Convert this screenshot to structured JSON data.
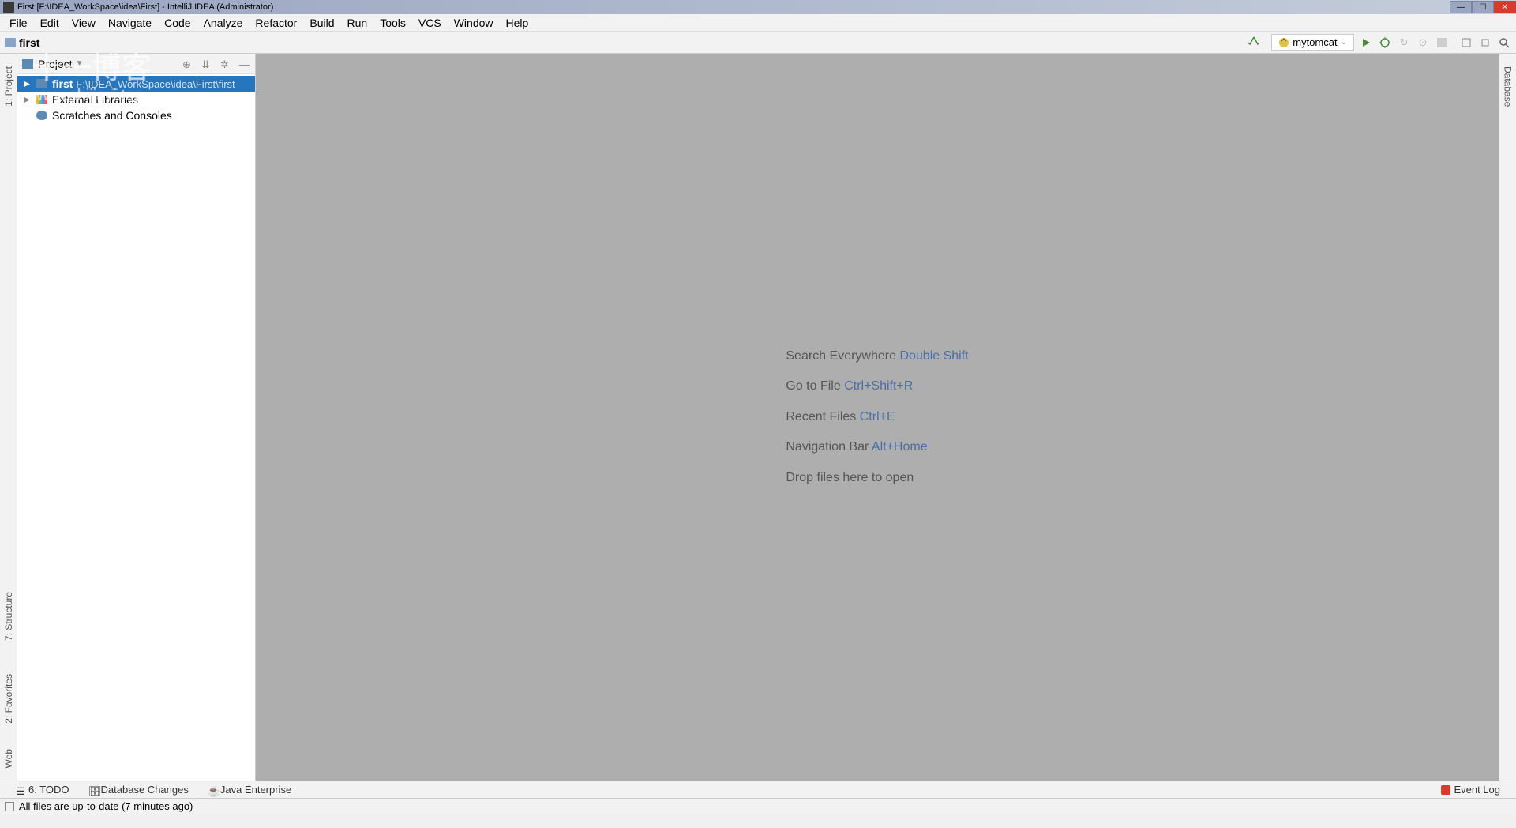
{
  "title": "First [F:\\IDEA_WorkSpace\\idea\\First] - IntelliJ IDEA (Administrator)",
  "menu": [
    "File",
    "Edit",
    "View",
    "Navigate",
    "Code",
    "Analyze",
    "Refactor",
    "Build",
    "Run",
    "Tools",
    "VCS",
    "Window",
    "Help"
  ],
  "breadcrumb": {
    "name": "first"
  },
  "runconfig": "mytomcat",
  "project_header": "Project",
  "tree": {
    "root": {
      "name": "first",
      "path": "F:\\IDEA_WorkSpace\\idea\\First\\first"
    },
    "ext_lib": "External Libraries",
    "scratches": "Scratches and Consoles"
  },
  "hints": [
    {
      "label": "Search Everywhere",
      "shortcut": "Double Shift"
    },
    {
      "label": "Go to File",
      "shortcut": "Ctrl+Shift+R"
    },
    {
      "label": "Recent Files",
      "shortcut": "Ctrl+E"
    },
    {
      "label": "Navigation Bar",
      "shortcut": "Alt+Home"
    },
    {
      "label": "Drop files here to open",
      "shortcut": ""
    }
  ],
  "left_gutter": [
    "1: Project",
    "7: Structure",
    "2: Favorites",
    "Web"
  ],
  "right_gutter": [
    "Database"
  ],
  "bottom_tabs": [
    "6: TODO",
    "Database Changes",
    "Java Enterprise"
  ],
  "event_log": "Event Log",
  "status": "All files are up-to-date (7 minutes ago)",
  "watermark": {
    "top": "十一博客",
    "sub": "www.shijiayi.top"
  }
}
